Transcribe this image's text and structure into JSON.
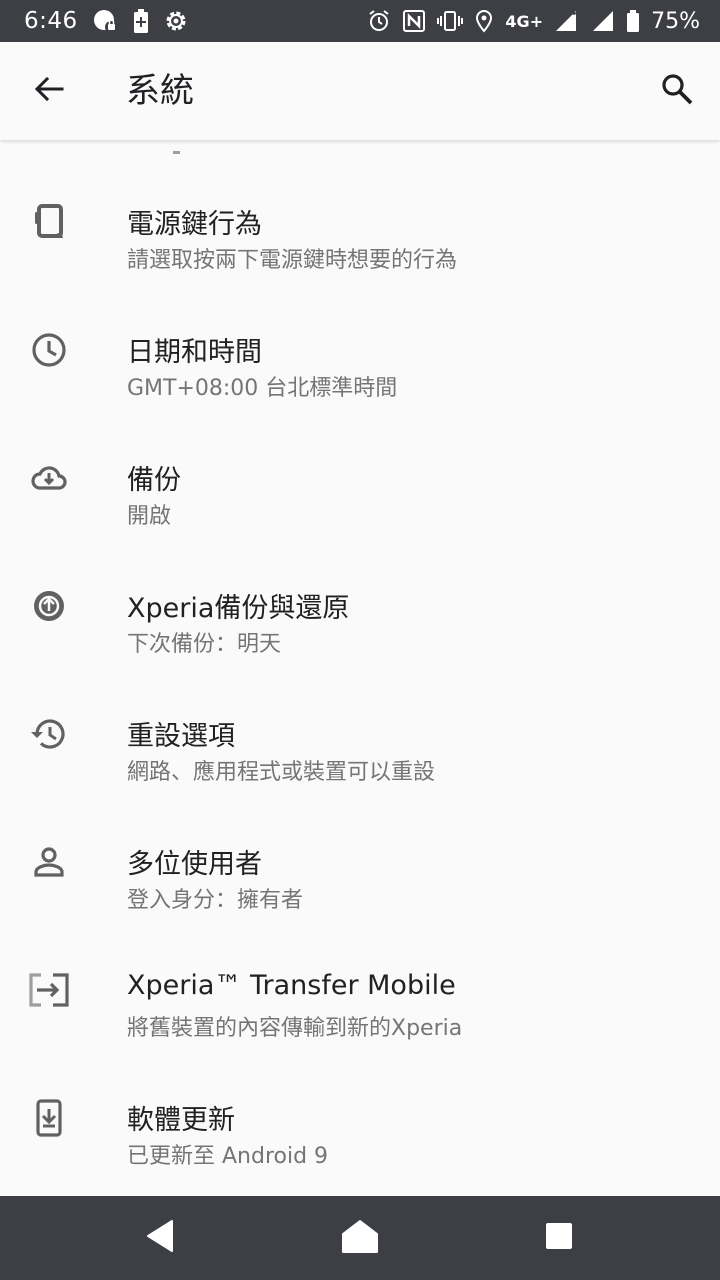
{
  "status_bar": {
    "time": "6:46",
    "network_label": "4G+",
    "battery_percent": "75%",
    "left_icons": [
      "chat-bubble-icon",
      "battery-saver-icon",
      "gear-icon"
    ],
    "right_icons": [
      "alarm-icon",
      "nfc-icon",
      "vibrate-icon",
      "location-icon",
      "signal-icon",
      "signal-icon",
      "battery-icon"
    ]
  },
  "app_bar": {
    "title": "系統",
    "back_icon": "arrow-back-icon",
    "search_icon": "search-icon"
  },
  "settings": [
    {
      "title": "電源鍵行為",
      "subtitle": "請選取按兩下電源鍵時想要的行為",
      "icon": "power-key-phone-icon"
    },
    {
      "title": "日期和時間",
      "subtitle": "GMT+08:00 台北標準時間",
      "icon": "clock-icon"
    },
    {
      "title": "備份",
      "subtitle": "開啟",
      "icon": "cloud-download-icon"
    },
    {
      "title": "Xperia備份與還原",
      "subtitle": "下次備份：明天",
      "icon": "backup-restore-icon"
    },
    {
      "title": "重設選項",
      "subtitle": "網路、應用程式或裝置可以重設",
      "icon": "history-icon"
    },
    {
      "title": "多位使用者",
      "subtitle": "登入身分：擁有者",
      "icon": "person-icon"
    },
    {
      "title": "Xperia™ Transfer Mobile",
      "subtitle": "將舊裝置的內容傳輸到新的Xperia",
      "icon": "transfer-icon"
    },
    {
      "title": "軟體更新",
      "subtitle": "已更新至 Android 9",
      "icon": "system-update-icon"
    }
  ],
  "nav_bar": {
    "buttons": [
      "back-triangle-icon",
      "home-icon",
      "recents-icon"
    ]
  },
  "colors": {
    "status_bar_bg": "#3d3f45",
    "nav_bar_bg": "#3d3f45",
    "background": "#fafafa",
    "primary_text": "#212121",
    "secondary_text": "#757575",
    "icon": "#616161"
  }
}
